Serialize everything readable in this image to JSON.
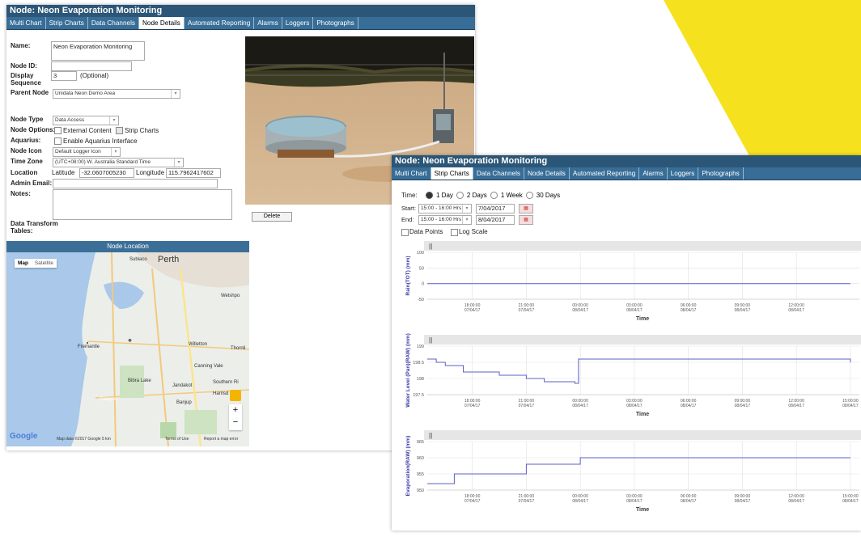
{
  "window1": {
    "title": "Node: Neon Evaporation Monitoring",
    "tabs": [
      "Multi Chart",
      "Strip Charts",
      "Data Channels",
      "Node Details",
      "Automated Reporting",
      "Alarms",
      "Loggers",
      "Photographs"
    ],
    "active_tab": "Node Details",
    "form": {
      "name_label": "Name:",
      "name_value": "Neon Evaporation Monitoring",
      "node_id_label": "Node ID:",
      "display_sequence_label": "Display Sequence",
      "display_sequence_value": "3",
      "optional_text": "(Optional)",
      "parent_node_label": "Parent Node",
      "parent_node_value": "Unidata Neon Demo Area",
      "node_type_label": "Node Type",
      "node_type_value": "Data Access",
      "node_options_label": "Node Options:",
      "external_content_label": "External Content",
      "strip_charts_label": "Strip Charts",
      "aquarius_label": "Aquarius:",
      "enable_aquarius_label": "Enable Aquarius Interface",
      "node_icon_label": "Node Icon",
      "node_icon_value": "Default Logger Icon",
      "time_zone_label": "Time Zone",
      "time_zone_value": "(UTC+08:00) W. Australia Standard Time",
      "location_label": "Location",
      "latitude_label": "Latitude",
      "latitude_value": "-32.0607005230",
      "longitude_label": "Longitude",
      "longitude_value": "115.7962417602",
      "admin_email_label": "Admin Email:",
      "notes_label": "Notes:",
      "data_transform_label": "Data Transform Tables:",
      "delete_label": "Delete"
    },
    "map": {
      "header": "Node Location",
      "map_btn": "Map",
      "satellite_btn": "Satellite",
      "place_perth": "Perth",
      "place_subiaco": "Subiaco",
      "place_welshpool": "Welshpo",
      "place_fremantle": "Fremantle",
      "place_willetton": "Willetton",
      "place_thornlie": "Thornli",
      "place_canning_vale": "Canning Vale",
      "place_bibra_lake": "Bibra Lake",
      "place_jandakot": "Jandakot",
      "place_southern_river": "Southern Ri",
      "place_harrisdale": "Harrisd",
      "place_coogee": "Coogee",
      "place_banjup": "Banjup",
      "google": "Google",
      "footer": "Map data ©2017 Google   5 km",
      "terms": "Terms of Use",
      "report": "Report a map error",
      "zoom_in": "+",
      "zoom_out": "−"
    }
  },
  "window2": {
    "title": "Node: Neon Evaporation Monitoring",
    "tabs": [
      "Multi Chart",
      "Strip Charts",
      "Data Channels",
      "Node Details",
      "Automated Reporting",
      "Alarms",
      "Loggers",
      "Photographs"
    ],
    "active_tab": "Strip Charts",
    "time_label": "Time:",
    "time_options": [
      "1 Day",
      "2 Days",
      "1 Week",
      "30 Days"
    ],
    "time_selected": "1 Day",
    "start_label": "Start:",
    "start_time": "15:00 - 16:00 Hrs",
    "start_date": "7/04/2017",
    "end_label": "End:",
    "end_time": "15:00 - 16:00 Hrs",
    "end_date": "8/04/2017",
    "data_points_label": "Data Points",
    "log_scale_label": "Log Scale",
    "axis_time_label": "Time",
    "handle_glyph": "||"
  },
  "chart_data": [
    {
      "type": "line",
      "title": "",
      "ylabel": "Rain(TOT) (mm)",
      "xlabel": "Time",
      "ylim": [
        -50,
        100
      ],
      "yticks": [
        100,
        50,
        0,
        -50
      ],
      "xticks": [
        "18:00:00 07/04/17",
        "21:00:00 07/04/17",
        "00:00:00 08/04/17",
        "03:00:00 08/04/17",
        "06:00:00 08/04/17",
        "09:00:00 08/04/17",
        "12:00:00 08/04/17"
      ],
      "series": [
        {
          "x": [
            15.5,
            39.0
          ],
          "y": [
            0,
            0
          ]
        }
      ],
      "color": "#5b5fc7"
    },
    {
      "type": "line",
      "title": "",
      "ylabel": "Water Level (Pan)(RAW) (mm)",
      "xlabel": "Time",
      "ylim": [
        197.5,
        199
      ],
      "yticks": [
        199,
        198.5,
        198,
        197.5
      ],
      "xticks": [
        "18:00:00 07/04/17",
        "21:00:00 07/04/17",
        "00:00:00 08/04/17",
        "03:00:00 08/04/17",
        "06:00:00 08/04/17",
        "09:00:00 08/04/17",
        "12:00:00 08/04/17",
        "15:00:00 08/04/17"
      ],
      "series": [
        {
          "x": [
            15.5,
            16.0,
            16.0,
            16.5,
            16.5,
            17.5,
            17.5,
            19.5,
            19.5,
            21.0,
            21.0,
            22.0,
            22.0,
            23.7,
            23.7,
            23.9,
            23.9,
            39.0,
            39.0
          ],
          "y": [
            198.6,
            198.6,
            198.5,
            198.5,
            198.4,
            198.4,
            198.2,
            198.2,
            198.1,
            198.1,
            198.0,
            198.0,
            197.9,
            197.9,
            197.85,
            197.85,
            198.6,
            198.6,
            198.5
          ]
        }
      ],
      "color": "#5b5fc7"
    },
    {
      "type": "line",
      "title": "",
      "ylabel": "Evaporation(RAW) (mm)",
      "xlabel": "Time",
      "ylim": [
        950,
        965
      ],
      "yticks": [
        965,
        960,
        955,
        950
      ],
      "xticks": [
        "18:00:00 07/04/17",
        "21:00:00 07/04/17",
        "00:00:00 08/04/17",
        "03:00:00 08/04/17",
        "06:00:00 08/04/17",
        "09:00:00 08/04/17",
        "12:00:00 08/04/17",
        "15:00:00 08/04/17"
      ],
      "series": [
        {
          "x": [
            15.5,
            17.0,
            17.0,
            21.0,
            21.0,
            24.0,
            24.0,
            39.0
          ],
          "y": [
            952,
            952,
            955,
            955,
            958,
            958,
            960,
            960
          ]
        }
      ],
      "color": "#5b5fc7"
    }
  ],
  "colors": {
    "title_bar": "#2c5677",
    "tab_bar": "#376d96",
    "accent_yellow": "#f7e01d",
    "series": "#5b5fc7"
  }
}
